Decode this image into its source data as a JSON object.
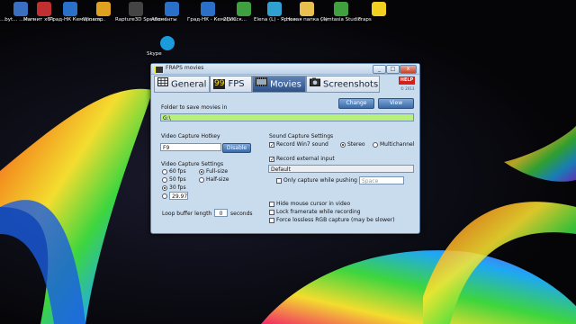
{
  "desktop": {
    "icons": [
      {
        "label": "...byt... ...ware",
        "color": "#3a6ec0"
      },
      {
        "label": "Магнит х64",
        "color": "#c03030"
      },
      {
        "label": "Град-НК Кемеровск...",
        "color": "#2a70c8"
      },
      {
        "label": "Winamp",
        "color": "#e0a020"
      },
      {
        "label": "Rapture3D Speaker L...",
        "color": "#444"
      },
      {
        "label": "Абоненты",
        "color": "#2a70c8"
      },
      {
        "label": "Град-НК - Кемеровск...",
        "color": "#2a70c8"
      },
      {
        "label": "2ГИС",
        "color": "#40a040"
      },
      {
        "label": "Elena (L) - Ярлык",
        "color": "#30a0d0"
      },
      {
        "label": "Новая папка (4)",
        "color": "#e8c050"
      },
      {
        "label": "Camtasia Studio",
        "color": "#40a040"
      },
      {
        "label": "Fraps",
        "color": "#f0d020"
      }
    ],
    "skype_label": "Skype"
  },
  "window": {
    "title": "FRAPS movies",
    "minimize_icon": "_",
    "maximize_icon": "□",
    "close_icon": "x",
    "tabs": [
      "General",
      "FPS",
      "Movies",
      "Screenshots"
    ],
    "fps_badge": "99",
    "active_tab": "Movies",
    "help_label": "HELP",
    "copyright": "© 2013"
  },
  "movies": {
    "folder_label": "Folder to save movies in",
    "folder_value": "G:\\",
    "change_label": "Change",
    "view_label": "View",
    "hotkey_label": "Video Capture Hotkey",
    "hotkey_value": "F9",
    "disable_label": "Disable",
    "settings_label": "Video Capture Settings",
    "fps_options": [
      "60 fps",
      "50 fps",
      "30 fps"
    ],
    "fps_selected": "30 fps",
    "custom_fps": "29.97",
    "size_options": [
      "Full-size",
      "Half-size"
    ],
    "size_selected": "Full-size",
    "loop_label": "Loop buffer length",
    "loop_value": "0",
    "loop_unit": "seconds",
    "sound_label": "Sound Capture Settings",
    "record_win7": "Record Win7 sound",
    "stereo": "Stereo",
    "multichannel": "Multichannel",
    "record_external": "Record external input",
    "input_device": "Default",
    "only_capture": "Only capture while pushing",
    "push_key": "Space",
    "hide_cursor": "Hide mouse cursor in video",
    "lock_framerate": "Lock framerate while recording",
    "force_rgb": "Force lossless RGB capture (may be slower)"
  },
  "colors": {
    "window_bg": "#c9dcee",
    "folder_field": "#b7f07a",
    "active_tab": "#2c4f86",
    "help": "#d4201a"
  }
}
